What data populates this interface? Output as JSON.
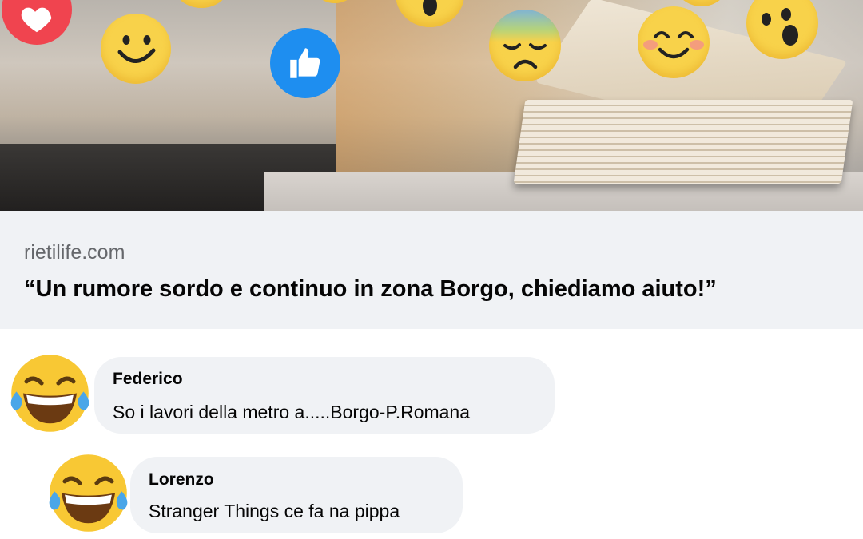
{
  "link_preview": {
    "domain": "rietilife.com",
    "title": "“Un rumore sordo e continuo in zona Borgo, chiediamo aiuto!”"
  },
  "reactions": [
    "heart-icon",
    "smile-icon",
    "like-icon",
    "surprised-icon",
    "worried-icon",
    "blush-icon",
    "wow-icon"
  ],
  "comments": [
    {
      "author": "Federico",
      "text": "So i lavori della metro a.....Borgo-P.Romana",
      "avatar": "laughing-tears-emoji"
    },
    {
      "author": "Lorenzo",
      "text": "Stranger Things ce fa na pippa",
      "avatar": "laughing-tears-emoji"
    }
  ],
  "colors": {
    "bubble": "#f0f2f5",
    "like_blue": "#1e8ef0",
    "heart_red": "#f0444f",
    "emoji_yellow": "#f8d24a"
  }
}
